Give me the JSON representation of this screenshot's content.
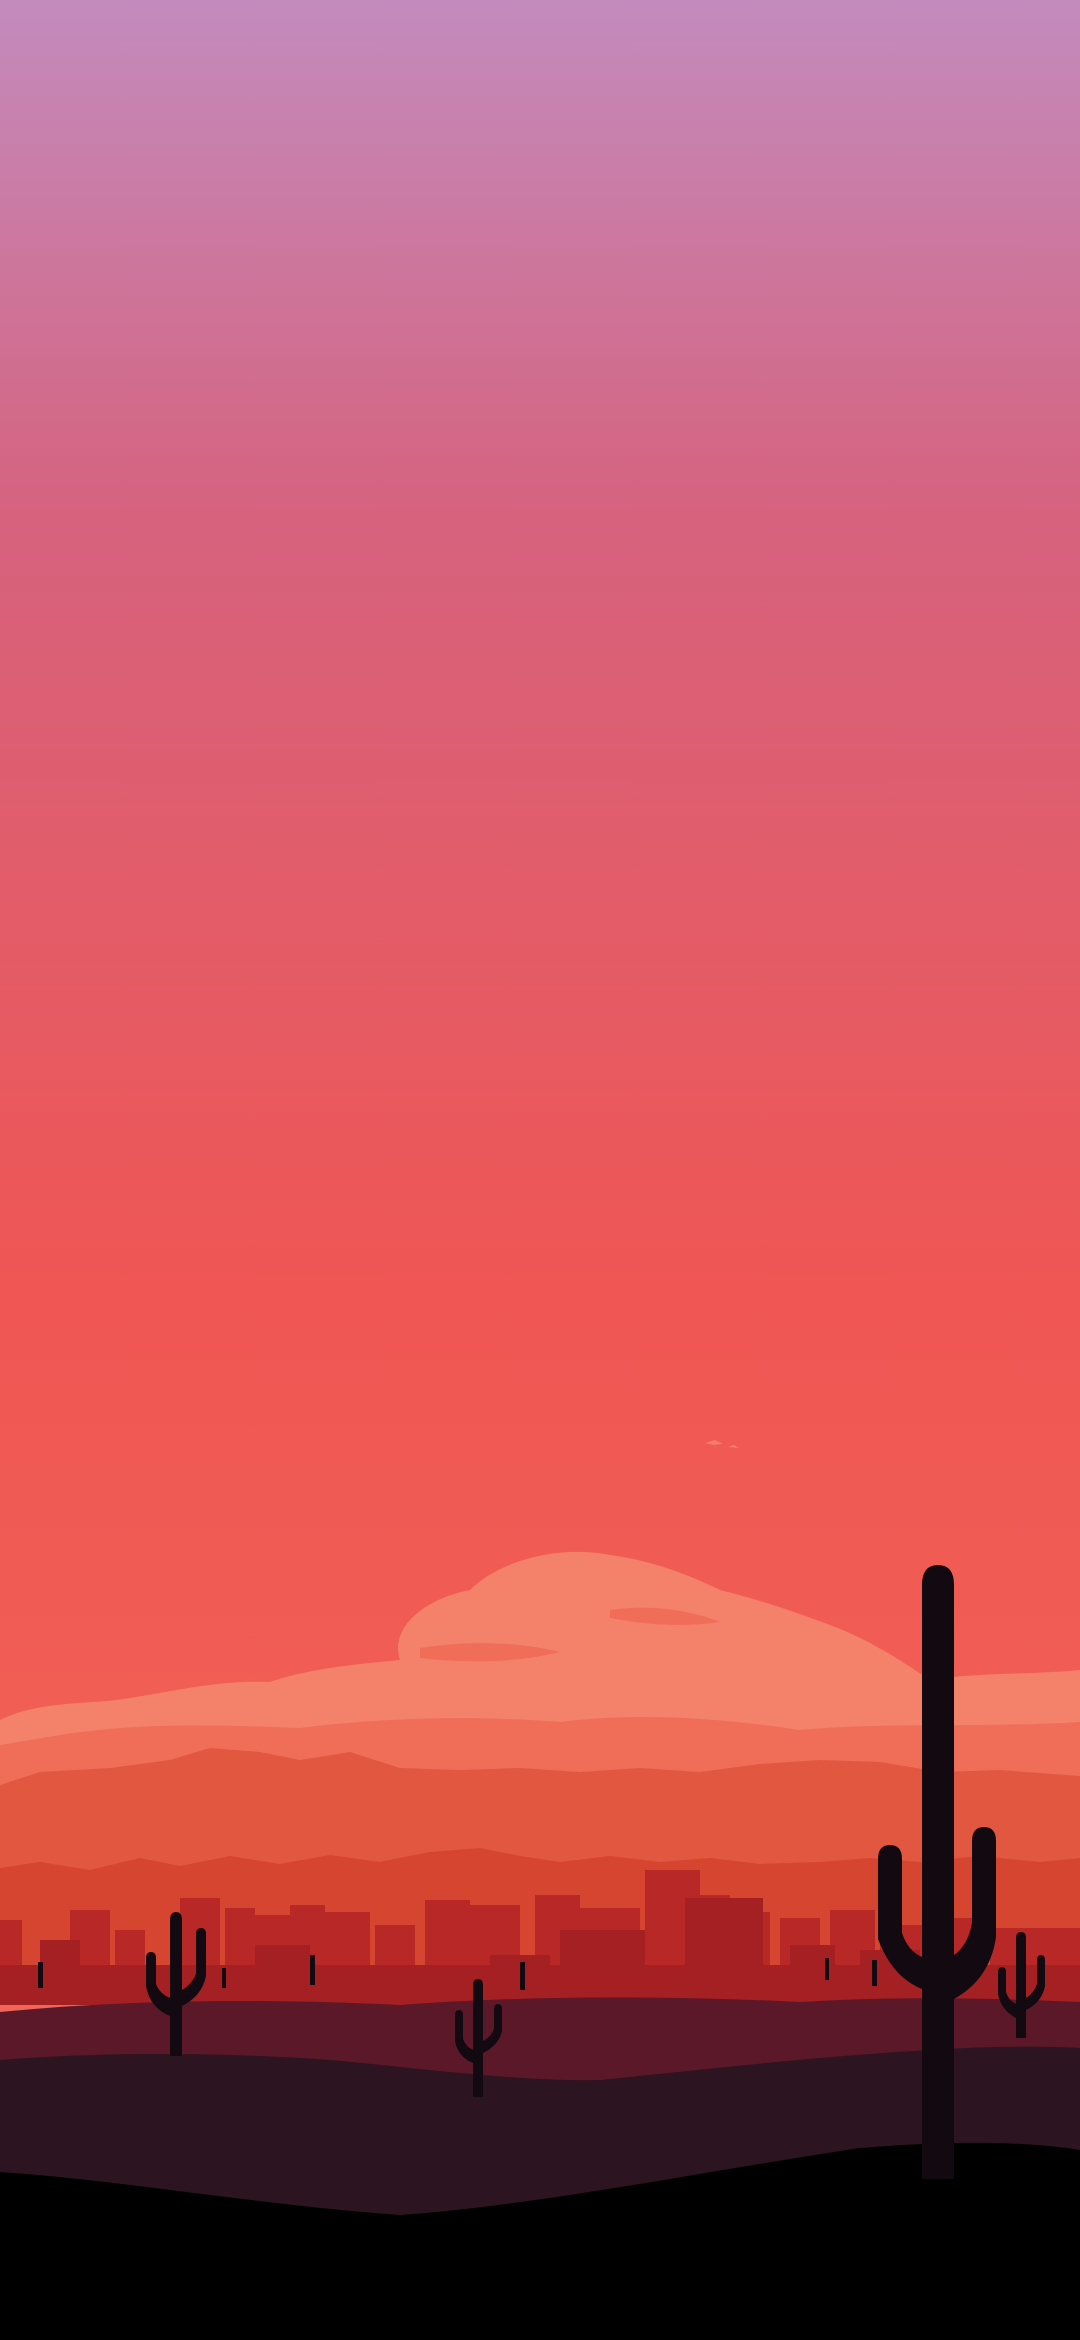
{
  "wallpaper": {
    "subject": "desert-sunset-cityscape",
    "colors": {
      "sky_top": "#c38bbd",
      "sky_mid_upper": "#d6627e",
      "sky_mid": "#ef5654",
      "sky_lower": "#f46a55",
      "cloud": "#f4826a",
      "cloud_shadow": "#f06e58",
      "far_mountains": "#e2573f",
      "mid_mountains": "#d5452f",
      "city": "#b72826",
      "city_dark": "#a52023",
      "near_ground": "#5a1828",
      "dark_hill": "#2c1420",
      "foreground": "#000000",
      "cactus": "#120a10"
    }
  }
}
